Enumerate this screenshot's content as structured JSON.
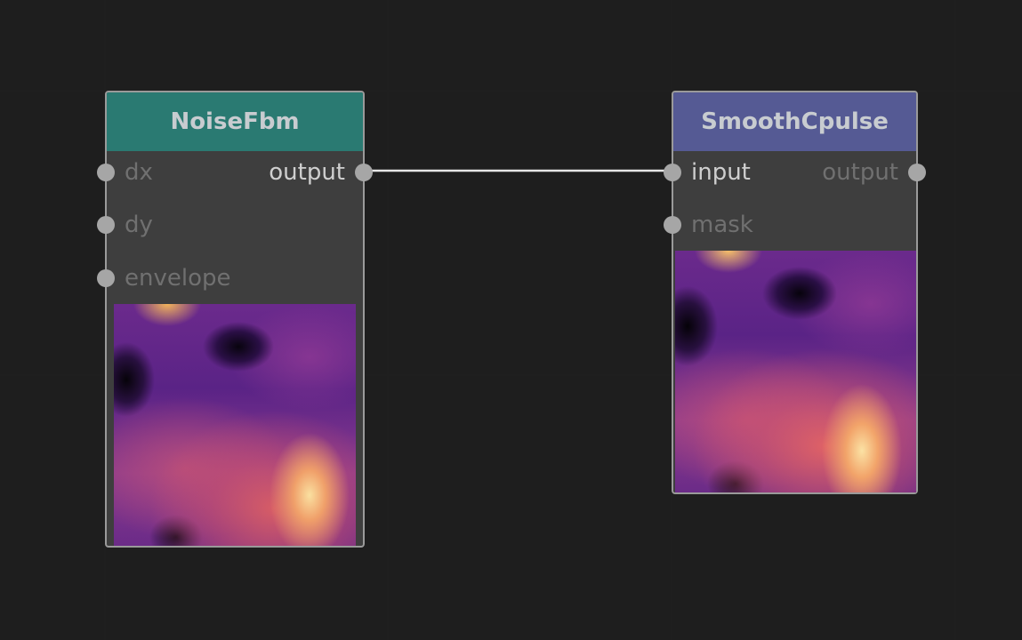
{
  "colors": {
    "canvas_bg": "#353535",
    "node_bg": "#3e3e3e",
    "noise_header": "#2a7a72",
    "pulse_header": "#555a94",
    "port": "#a6a6a6",
    "wire": "#e6e6e6"
  },
  "nodes": {
    "noise_fbm": {
      "title": "NoiseFbm",
      "inputs": [
        {
          "label": "dx",
          "connected": false
        },
        {
          "label": "dy",
          "connected": false
        },
        {
          "label": "envelope",
          "connected": false
        }
      ],
      "outputs": [
        {
          "label": "output",
          "connected": true
        }
      ],
      "preview_icon": "noise-texture-preview"
    },
    "smooth_cpulse": {
      "title": "SmoothCpulse",
      "inputs": [
        {
          "label": "input",
          "connected": true
        },
        {
          "label": "mask",
          "connected": false
        }
      ],
      "outputs": [
        {
          "label": "output",
          "connected": false
        }
      ],
      "preview_icon": "pulse-texture-preview"
    }
  },
  "connections": [
    {
      "from": "NoiseFbm.output",
      "to": "SmoothCpulse.input"
    }
  ]
}
